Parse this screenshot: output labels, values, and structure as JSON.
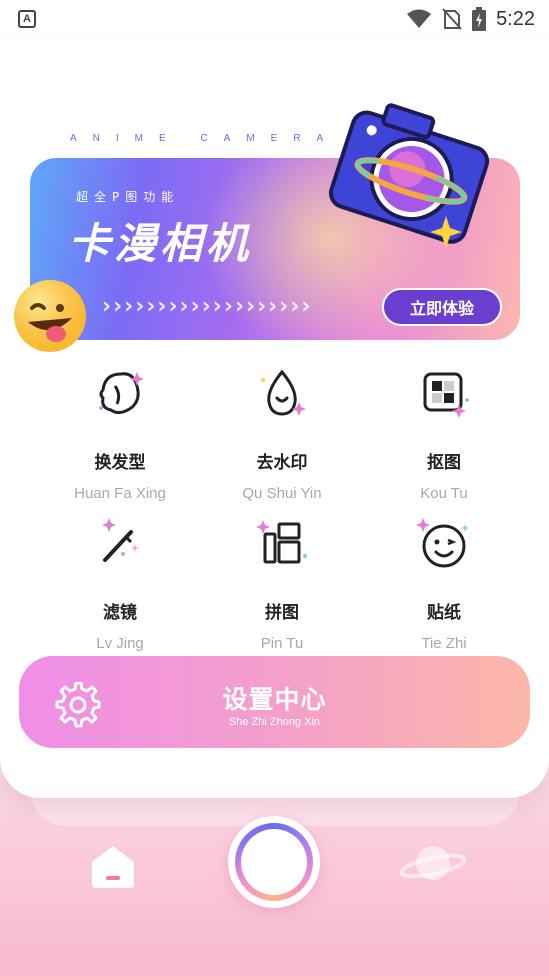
{
  "status_bar": {
    "app_badge": "A",
    "time": "5:22"
  },
  "banner": {
    "tagline": "ANIME CAMERA",
    "subtitle": "超全P图功能",
    "title": "卡漫相机",
    "cta_label": "立即体验"
  },
  "features": [
    {
      "title": "换发型",
      "subtitle": "Huan Fa Xing",
      "icon": "hair-head-icon"
    },
    {
      "title": "去水印",
      "subtitle": "Qu Shui Yin",
      "icon": "water-drop-icon"
    },
    {
      "title": "抠图",
      "subtitle": "Kou Tu",
      "icon": "cutout-icon"
    },
    {
      "title": "滤镜",
      "subtitle": "Lv Jing",
      "icon": "magic-wand-icon"
    },
    {
      "title": "拼图",
      "subtitle": "Pin Tu",
      "icon": "collage-icon"
    },
    {
      "title": "贴纸",
      "subtitle": "Tie Zhi",
      "icon": "sticker-smile-icon"
    }
  ],
  "settings": {
    "title": "设置中心",
    "subtitle": "She Zhi Zhong Xin"
  },
  "nav": {
    "home_icon": "home-icon",
    "shutter_icon": "shutter-button",
    "planet_icon": "planet-icon"
  },
  "colors": {
    "accent_purple": "#6a3fd0",
    "banner_start": "#5ea8f8",
    "banner_end": "#fbb8b0",
    "settings_start": "#ef8ee8",
    "settings_end": "#fbb7a8"
  }
}
